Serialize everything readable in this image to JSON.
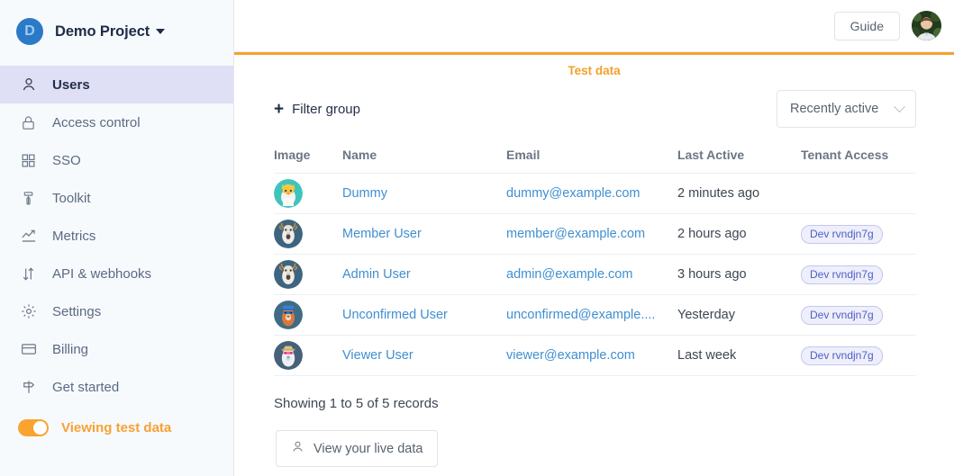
{
  "sidebar": {
    "brand": {
      "initial": "D",
      "name": "Demo Project"
    },
    "items": [
      {
        "label": "Users",
        "icon": "user-icon",
        "active": true
      },
      {
        "label": "Access control",
        "icon": "lock-icon",
        "active": false
      },
      {
        "label": "SSO",
        "icon": "grid-icon",
        "active": false
      },
      {
        "label": "Toolkit",
        "icon": "toolkit-icon",
        "active": false
      },
      {
        "label": "Metrics",
        "icon": "trending-up-icon",
        "active": false
      },
      {
        "label": "API & webhooks",
        "icon": "arrows-icon",
        "active": false
      },
      {
        "label": "Settings",
        "icon": "gear-icon",
        "active": false
      },
      {
        "label": "Billing",
        "icon": "credit-card-icon",
        "active": false
      },
      {
        "label": "Get started",
        "icon": "signpost-icon",
        "active": false
      }
    ],
    "test_toggle": {
      "label": "Viewing test data",
      "on": true,
      "color": "#f7a134"
    }
  },
  "topbar": {
    "guide_label": "Guide"
  },
  "banner": {
    "title": "Test data",
    "color": "#f2a02b"
  },
  "controls": {
    "filter_group_label": "Filter group",
    "plus": "+",
    "sort_select": {
      "value": "Recently active",
      "options": [
        "Recently active"
      ]
    }
  },
  "table": {
    "columns": [
      "Image",
      "Name",
      "Email",
      "Last Active",
      "Tenant Access"
    ],
    "rows": [
      {
        "name": "Dummy",
        "email": "dummy@example.com",
        "last_active": "2 minutes ago",
        "tenant": ""
      },
      {
        "name": "Member User",
        "email": "member@example.com",
        "last_active": "2 hours ago",
        "tenant": "Dev rvndjn7g"
      },
      {
        "name": "Admin User",
        "email": "admin@example.com",
        "last_active": "3 hours ago",
        "tenant": "Dev rvndjn7g"
      },
      {
        "name": "Unconfirmed User",
        "email": "unconfirmed@example....",
        "last_active": "Yesterday",
        "tenant": "Dev rvndjn7g"
      },
      {
        "name": "Viewer User",
        "email": "viewer@example.com",
        "last_active": "Last week",
        "tenant": "Dev rvndjn7g"
      }
    ]
  },
  "footer": {
    "showing": "Showing 1 to 5 of 5 records",
    "live_data_button": "View your live data"
  }
}
